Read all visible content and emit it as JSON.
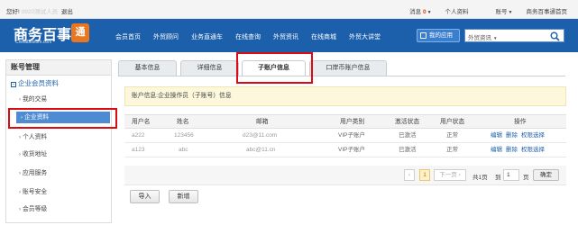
{
  "topbar": {
    "greeting": "您好!",
    "username": "0920测试人员",
    "logout": "退出",
    "messages_label": "消息",
    "messages_count": "0",
    "personal": "个人资料",
    "account": "账号",
    "site": "商务百事通首页"
  },
  "logo": {
    "title": "商务百事",
    "domain": "Chinabestom.com",
    "mark": "通"
  },
  "nav": {
    "items": [
      "会员首页",
      "外贸顾问",
      "业务直通车",
      "在线查询",
      "外贸资讯",
      "在线商城",
      "外贸大讲堂"
    ],
    "my_app": "我的应用",
    "search_select": "外贸资讯"
  },
  "sidebar": {
    "title": "账号管理",
    "group": "企业会员资料",
    "items": [
      "我的交易",
      "企业资料",
      "个人资料",
      "收货地址",
      "应用服务",
      "账号安全",
      "会员等级"
    ]
  },
  "tabs": [
    "基本信息",
    "详细信息",
    "子账户信息",
    "口岸币账户信息"
  ],
  "info_text": "账户信息:企业操作员（子账号）信息",
  "table": {
    "headers": [
      "用户名",
      "姓名",
      "邮箱",
      "用户类别",
      "激活状态",
      "用户状态",
      "操作"
    ],
    "rows": [
      {
        "username": "a222",
        "name": "123456",
        "email": "d23@11.com",
        "type": "VIP子账户",
        "activation": "已激活",
        "status": "正常"
      },
      {
        "username": "a123",
        "name": "abc",
        "email": "abc@11.cn",
        "type": "VIP子账户",
        "activation": "已激活",
        "status": "正常"
      }
    ],
    "actions": [
      "编辑",
      "删除",
      "权限选择"
    ]
  },
  "pager": {
    "prev": "‹",
    "current": "1",
    "next": "下一页 ›",
    "total": "共1页",
    "goto": "到",
    "page_value": "1",
    "page_unit": "页",
    "confirm": "确定"
  },
  "buttons": {
    "import": "导入",
    "add": "新增"
  },
  "colors": {
    "nav_bg": "#1c5fab",
    "highlight": "#d90b13",
    "sidebar_active": "#4e8bd2",
    "info_bg": "#fdf7dc"
  }
}
